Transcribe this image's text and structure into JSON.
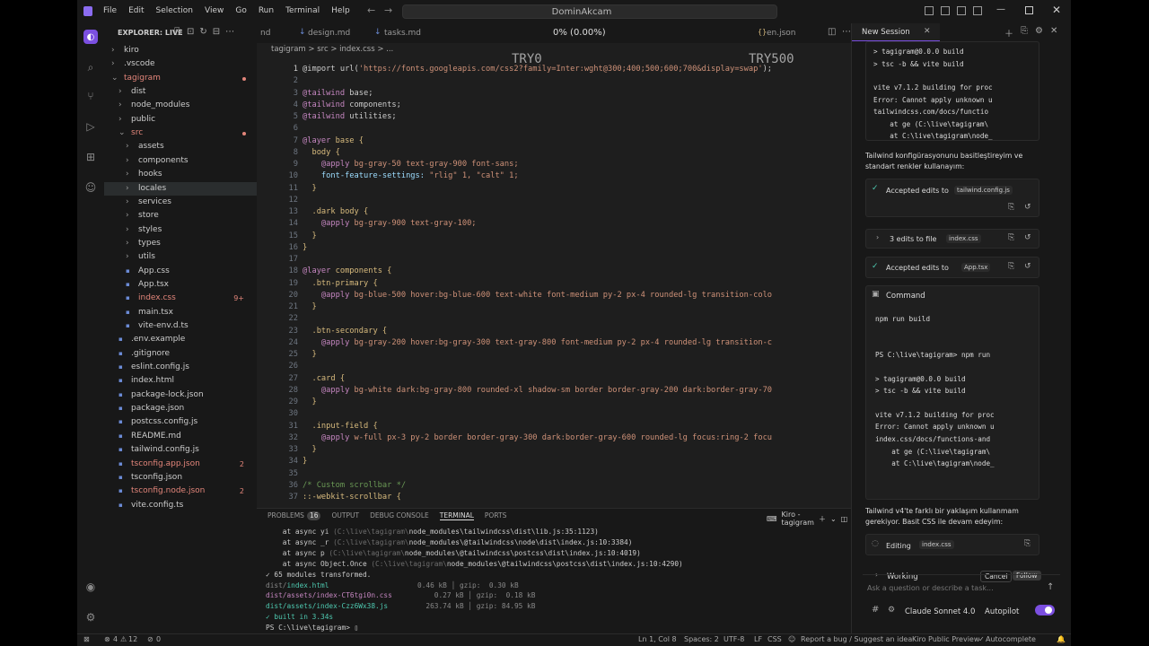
{
  "window": {
    "title": "DominAkcam"
  },
  "menu": [
    "File",
    "Edit",
    "Selection",
    "View",
    "Go",
    "Run",
    "Terminal",
    "Help"
  ],
  "explorer": {
    "header": "EXPLORER: LIVE",
    "items": [
      {
        "label": "kiro",
        "depth": 0,
        "kind": "dir",
        "color": "#cccccc"
      },
      {
        "label": ".vscode",
        "depth": 0,
        "kind": "dir",
        "color": "#cccccc"
      },
      {
        "label": "tagigram",
        "depth": 0,
        "kind": "diropen",
        "color": "#e2857a",
        "dot": true
      },
      {
        "label": "dist",
        "depth": 1,
        "kind": "dir",
        "color": "#cccccc"
      },
      {
        "label": "node_modules",
        "depth": 1,
        "kind": "dir",
        "color": "#cccccc"
      },
      {
        "label": "public",
        "depth": 1,
        "kind": "dir",
        "color": "#cccccc"
      },
      {
        "label": "src",
        "depth": 1,
        "kind": "diropen",
        "color": "#e2857a",
        "dot": true
      },
      {
        "label": "assets",
        "depth": 2,
        "kind": "dir",
        "color": "#cccccc"
      },
      {
        "label": "components",
        "depth": 2,
        "kind": "dir",
        "color": "#cccccc"
      },
      {
        "label": "hooks",
        "depth": 2,
        "kind": "dir",
        "color": "#cccccc"
      },
      {
        "label": "locales",
        "depth": 2,
        "kind": "dir",
        "color": "#cccccc",
        "selected": true
      },
      {
        "label": "services",
        "depth": 2,
        "kind": "dir",
        "color": "#cccccc"
      },
      {
        "label": "store",
        "depth": 2,
        "kind": "dir",
        "color": "#cccccc"
      },
      {
        "label": "styles",
        "depth": 2,
        "kind": "dir",
        "color": "#cccccc"
      },
      {
        "label": "types",
        "depth": 2,
        "kind": "dir",
        "color": "#cccccc"
      },
      {
        "label": "utils",
        "depth": 2,
        "kind": "dir",
        "color": "#cccccc"
      },
      {
        "label": "App.css",
        "depth": 2,
        "kind": "file",
        "color": "#cccccc"
      },
      {
        "label": "App.tsx",
        "depth": 2,
        "kind": "file",
        "color": "#cccccc"
      },
      {
        "label": "index.css",
        "depth": 2,
        "kind": "file",
        "color": "#e2857a",
        "badge": "9+"
      },
      {
        "label": "main.tsx",
        "depth": 2,
        "kind": "file",
        "color": "#cccccc"
      },
      {
        "label": "vite-env.d.ts",
        "depth": 2,
        "kind": "file",
        "color": "#cccccc"
      },
      {
        "label": ".env.example",
        "depth": 1,
        "kind": "file",
        "color": "#cccccc"
      },
      {
        "label": ".gitignore",
        "depth": 1,
        "kind": "file",
        "color": "#cccccc"
      },
      {
        "label": "eslint.config.js",
        "depth": 1,
        "kind": "file",
        "color": "#cccccc"
      },
      {
        "label": "index.html",
        "depth": 1,
        "kind": "file",
        "color": "#cccccc"
      },
      {
        "label": "package-lock.json",
        "depth": 1,
        "kind": "file",
        "color": "#cccccc"
      },
      {
        "label": "package.json",
        "depth": 1,
        "kind": "file",
        "color": "#cccccc"
      },
      {
        "label": "postcss.config.js",
        "depth": 1,
        "kind": "file",
        "color": "#cccccc"
      },
      {
        "label": "README.md",
        "depth": 1,
        "kind": "file",
        "color": "#cccccc"
      },
      {
        "label": "tailwind.config.js",
        "depth": 1,
        "kind": "file",
        "color": "#cccccc"
      },
      {
        "label": "tsconfig.app.json",
        "depth": 1,
        "kind": "file",
        "color": "#e2857a",
        "badge": "2"
      },
      {
        "label": "tsconfig.json",
        "depth": 1,
        "kind": "file",
        "color": "#cccccc"
      },
      {
        "label": "tsconfig.node.json",
        "depth": 1,
        "kind": "file",
        "color": "#e2857a",
        "badge": "2"
      },
      {
        "label": "vite.config.ts",
        "depth": 1,
        "kind": "file",
        "color": "#cccccc"
      }
    ]
  },
  "tabs": {
    "items": [
      "nd",
      "design.md",
      "tasks.md",
      "en.json"
    ],
    "progress": "0% (0.00%)"
  },
  "breadcrumb": "tagigram  >  src  >  index.css  >  ...",
  "overlay": {
    "left": "TRY0",
    "right": "TRY500"
  },
  "code": [
    [
      [
        "@import url(",
        "#cccccc"
      ],
      [
        "'https://fonts.googleapis.com/css2?family=Inter:wght@300;400;500;600;700&display=swap'",
        "#ce9178"
      ],
      [
        ");",
        "#cccccc"
      ]
    ],
    [],
    [
      [
        "@tailwind",
        "#c586c0"
      ],
      [
        " base;",
        "#cccccc"
      ]
    ],
    [
      [
        "@tailwind",
        "#c586c0"
      ],
      [
        " components;",
        "#cccccc"
      ]
    ],
    [
      [
        "@tailwind",
        "#c586c0"
      ],
      [
        " utilities;",
        "#cccccc"
      ]
    ],
    [],
    [
      [
        "@layer",
        "#c586c0"
      ],
      [
        " base {",
        "#d7ba7d"
      ]
    ],
    [
      [
        "  body {",
        "#d7ba7d"
      ]
    ],
    [
      [
        "    @apply",
        "#c586c0"
      ],
      [
        " bg-gray-50 text-gray-900 font-sans;",
        "#ce9178"
      ]
    ],
    [
      [
        "    font-feature-settings: ",
        "#9cdcfe"
      ],
      [
        "\"rlig\" 1, \"calt\" 1;",
        "#ce9178"
      ]
    ],
    [
      [
        "  }",
        "#d7ba7d"
      ]
    ],
    [],
    [
      [
        "  .dark body {",
        "#d7ba7d"
      ]
    ],
    [
      [
        "    @apply",
        "#c586c0"
      ],
      [
        " bg-gray-900 text-gray-100;",
        "#ce9178"
      ]
    ],
    [
      [
        "  }",
        "#d7ba7d"
      ]
    ],
    [
      [
        "}",
        "#d7ba7d"
      ]
    ],
    [],
    [
      [
        "@layer",
        "#c586c0"
      ],
      [
        " components {",
        "#d7ba7d"
      ]
    ],
    [
      [
        "  .btn-primary {",
        "#d7ba7d"
      ]
    ],
    [
      [
        "    @apply",
        "#c586c0"
      ],
      [
        " bg-blue-500 hover:bg-blue-600 text-white font-medium py-2 px-4 rounded-lg transition-colo",
        "#ce9178"
      ]
    ],
    [
      [
        "  }",
        "#d7ba7d"
      ]
    ],
    [],
    [
      [
        "  .btn-secondary {",
        "#d7ba7d"
      ]
    ],
    [
      [
        "    @apply",
        "#c586c0"
      ],
      [
        " bg-gray-200 hover:bg-gray-300 text-gray-800 font-medium py-2 px-4 rounded-lg transition-c",
        "#ce9178"
      ]
    ],
    [
      [
        "  }",
        "#d7ba7d"
      ]
    ],
    [],
    [
      [
        "  .card {",
        "#d7ba7d"
      ]
    ],
    [
      [
        "    @apply",
        "#c586c0"
      ],
      [
        " bg-white dark:bg-gray-800 rounded-xl shadow-sm border border-gray-200 dark:border-gray-70",
        "#ce9178"
      ]
    ],
    [
      [
        "  }",
        "#d7ba7d"
      ]
    ],
    [],
    [
      [
        "  .input-field {",
        "#d7ba7d"
      ]
    ],
    [
      [
        "    @apply",
        "#c586c0"
      ],
      [
        " w-full px-3 py-2 border border-gray-300 dark:border-gray-600 rounded-lg focus:ring-2 focu",
        "#ce9178"
      ]
    ],
    [
      [
        "  }",
        "#d7ba7d"
      ]
    ],
    [
      [
        "}",
        "#d7ba7d"
      ]
    ],
    [],
    [
      [
        "/* Custom scrollbar */",
        "#6a9955"
      ]
    ],
    [
      [
        "::-webkit-scrollbar {",
        "#d7ba7d"
      ]
    ]
  ],
  "panel": {
    "tabs": [
      "PROBLEMS",
      "OUTPUT",
      "DEBUG CONSOLE",
      "TERMINAL",
      "PORTS"
    ],
    "problems_count": "16",
    "terminal_name": "Kiro - tagigram",
    "lines": [
      [
        [
          "    at async yi ",
          "#cccccc"
        ],
        [
          "(C:\\live\\tagigram\\",
          "#6e6e6e"
        ],
        [
          "node_modules\\tailwindcss\\dist\\lib.js:35:1123)",
          "#cccccc"
        ]
      ],
      [
        [
          "    at async _r ",
          "#cccccc"
        ],
        [
          "(C:\\live\\tagigram\\",
          "#6e6e6e"
        ],
        [
          "node_modules\\@tailwindcss\\node\\dist\\index.js:10:3384)",
          "#cccccc"
        ]
      ],
      [
        [
          "    at async p ",
          "#cccccc"
        ],
        [
          "(C:\\live\\tagigram\\",
          "#6e6e6e"
        ],
        [
          "node_modules\\@tailwindcss\\postcss\\dist\\index.js:10:4019)",
          "#cccccc"
        ]
      ],
      [
        [
          "    at async Object.Once ",
          "#cccccc"
        ],
        [
          "(C:\\live\\tagigram\\",
          "#6e6e6e"
        ],
        [
          "node_modules\\@tailwindcss\\postcss\\dist\\index.js:10:4290)",
          "#cccccc"
        ]
      ],
      [
        [
          "✓ 65 modules transformed.",
          "#cccccc"
        ]
      ],
      [
        [
          "dist/",
          "#888888"
        ],
        [
          "index.html",
          "#4ec9b0"
        ],
        [
          "                     0.46 kB │ gzip:  0.30 kB",
          "#888888"
        ]
      ],
      [
        [
          "dist/assets/index-CT6tgi0n.css",
          "#c586c0"
        ],
        [
          "          0.27 kB │ gzip:  0.18 kB",
          "#888888"
        ]
      ],
      [
        [
          "dist/assets/index-Czz6Wx38.js",
          "#4ec9b0"
        ],
        [
          "         263.74 kB │ gzip: 84.95 kB",
          "#888888"
        ]
      ],
      [
        [
          "✓ built in 3.34s",
          "#4ec9b0"
        ]
      ],
      [
        [
          "PS C:\\live\\tagigram> ",
          "#cccccc"
        ],
        [
          "▯",
          "#cccccc"
        ]
      ]
    ]
  },
  "chat": {
    "session_title": "New Session",
    "term1": [
      "> tagigram@0.0.0 build",
      "> tsc -b && vite build",
      "",
      "vite v7.1.2 building for proc",
      "Error: Cannot apply unknown u",
      "tailwindcss.com/docs/functio",
      "    at ge (C:\\live\\tagigram\\",
      "    at C:\\live\\tagigram\\node_"
    ],
    "msg1": "Tailwind konfigürasyonunu basitleştireyim ve standart renkler kullanayım:",
    "accepted1": {
      "label": "Accepted edits to",
      "file": "tailwind.config.js"
    },
    "edits": {
      "label": "3 edits to file",
      "file": "index.css"
    },
    "accepted2": {
      "label": "Accepted edits to",
      "file": "App.tsx"
    },
    "command": {
      "title": "Command",
      "cmd": "npm run build"
    },
    "term2": [
      "PS C:\\live\\tagigram> npm run",
      "",
      "> tagigram@0.0.0 build",
      "> tsc -b && vite build",
      "",
      "vite v7.1.2 building for proc",
      "Error: Cannot apply unknown u",
      "index.css/docs/functions-and",
      "    at ge (C:\\live\\tagigram\\",
      "    at C:\\live\\tagigram\\node_"
    ],
    "msg2": "Tailwind v4'te farklı bir yaklaşım kullanmam gerekiyor. Basit CSS ile devam edeyim:",
    "editing": {
      "label": "Editing",
      "file": "index.css"
    },
    "working": {
      "label": "Working",
      "cancel": "Cancel",
      "follow": "Follow"
    },
    "input_placeholder": "Ask a question or describe a task...",
    "model": "Claude Sonnet 4.0",
    "autopilot": "Autopilot"
  },
  "status": {
    "left_icon": "⚙",
    "errors": "4",
    "warnings": "12",
    "ports": "0",
    "items": [
      "Ln 1, Col 8",
      "Spaces: 2",
      "UTF-8",
      "LF",
      "CSS",
      "Report a bug / Suggest an idea",
      "Kiro Public Preview",
      "Autocomplete"
    ]
  }
}
